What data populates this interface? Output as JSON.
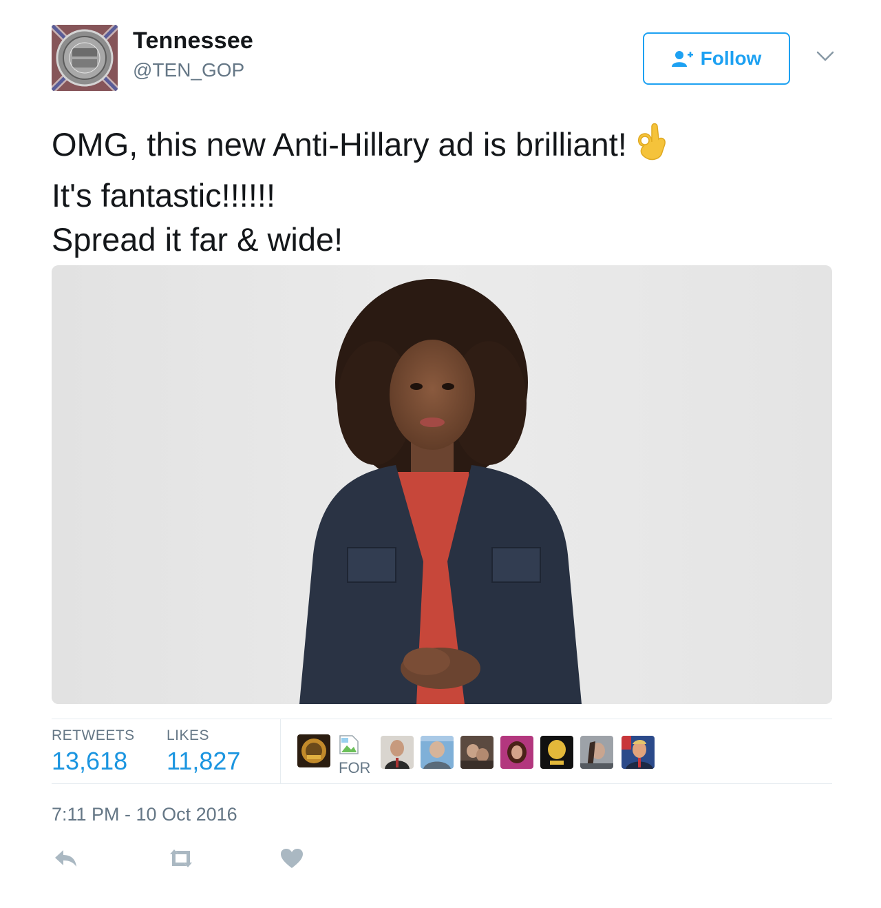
{
  "account": {
    "display_name": "Tennessee",
    "handle": "@TEN_GOP",
    "follow_label": "Follow"
  },
  "tweet": {
    "lines": [
      "OMG, this new Anti-Hillary ad is brilliant!",
      "It's fantastic!!!!!!",
      "Spread it far & wide!"
    ],
    "emoji": "ok-hand-emoji"
  },
  "stats": {
    "retweets_label": "RETWEETS",
    "retweets_count": "13,618",
    "likes_label": "LIKES",
    "likes_count": "11,827",
    "broken_image_alt": "FOR"
  },
  "timestamp": "7:11 PM - 10 Oct 2016",
  "actions": {
    "reply_icon": "reply-icon",
    "retweet_icon": "retweet-icon",
    "like_icon": "heart-icon"
  },
  "colors": {
    "accent": "#1da1f2",
    "link": "#1b95e0",
    "muted": "#657786",
    "action_gray": "#aab8c2"
  }
}
